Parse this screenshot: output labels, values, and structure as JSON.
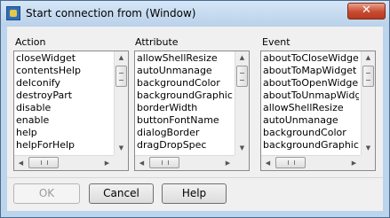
{
  "window": {
    "title": "Start connection from (Window)",
    "close_glyph": "✕",
    "app_icon": "app-icon"
  },
  "columns": {
    "action": {
      "label": "Action",
      "items": [
        "closeWidget",
        "contentsHelp",
        "deIconify",
        "destroyPart",
        "disable",
        "enable",
        "help",
        "helpForHelp"
      ]
    },
    "attribute": {
      "label": "Attribute",
      "items": [
        "allowShellResize",
        "autoUnmanage",
        "backgroundColor",
        "backgroundGraphicsI",
        "borderWidth",
        "buttonFontName",
        "dialogBorder",
        "dragDropSpec"
      ]
    },
    "event": {
      "label": "Event",
      "items": [
        "aboutToCloseWidge",
        "aboutToMapWidget",
        "aboutToOpenWidge",
        "aboutToUnmapWidg",
        "allowShellResize",
        "autoUnmanage",
        "backgroundColor",
        "backgroundGraphics"
      ]
    }
  },
  "scroll_glyphs": {
    "up": "▲",
    "down": "▼",
    "left": "◀",
    "right": "▶"
  },
  "buttons": {
    "ok": "OK",
    "cancel": "Cancel",
    "help": "Help"
  },
  "colors": {
    "title_bg": "#c4dbf1",
    "close_button": "#c74a2f",
    "dialog_bg": "#f0f0f0"
  }
}
